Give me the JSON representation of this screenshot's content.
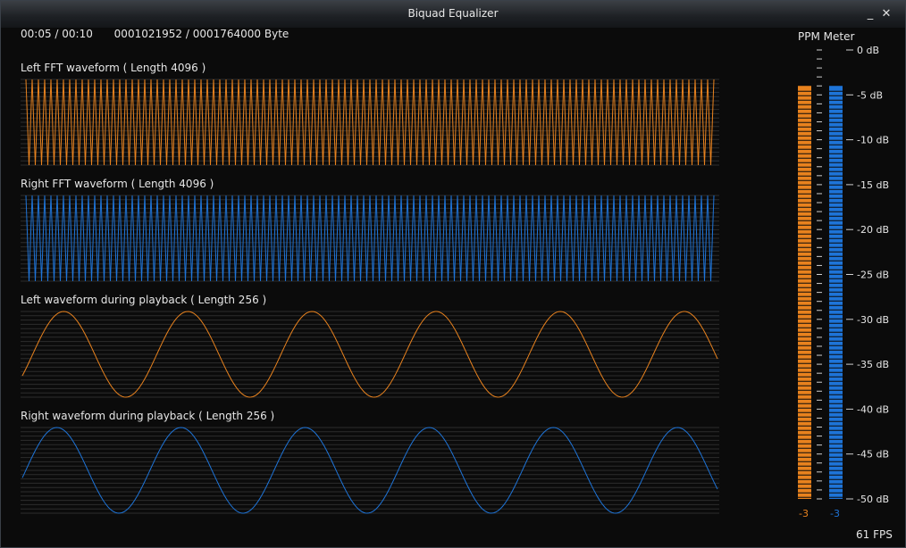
{
  "window": {
    "title": "Biquad Equalizer",
    "minimize_glyph": "_",
    "close_glyph": "✕"
  },
  "status": {
    "time": "00:05 / 00:10",
    "bytes": "0001021952 / 0001764000 Byte"
  },
  "waveforms": [
    {
      "label": "Left FFT waveform ( Length 4096 )",
      "color": "#e8821e",
      "style": "fft",
      "cycles": 110
    },
    {
      "label": "Right FFT waveform ( Length 4096 )",
      "color": "#1e74d8",
      "style": "fft",
      "cycles": 110
    },
    {
      "label": "Left waveform during playback ( Length 256 )",
      "color": "#e8821e",
      "style": "sine",
      "cycles": 5.6,
      "phase_deg": -30
    },
    {
      "label": "Right waveform during playback ( Length 256 )",
      "color": "#1e74d8",
      "style": "sine",
      "cycles": 5.6,
      "phase_deg": -10
    }
  ],
  "ppm": {
    "title": "PPM Meter",
    "scale": [
      "0 dB",
      "-5 dB",
      "-10 dB",
      "-15 dB",
      "-20 dB",
      "-25 dB",
      "-30 dB",
      "-35 dB",
      "-40 dB",
      "-45 dB",
      "-50 dB"
    ],
    "min_db": -50,
    "max_db": 0,
    "left": {
      "level_db": -4,
      "reading": "-3",
      "color": "#e8821e"
    },
    "right": {
      "level_db": -4,
      "reading": "-3",
      "color": "#1e74d8"
    }
  },
  "fps": "61  FPS"
}
